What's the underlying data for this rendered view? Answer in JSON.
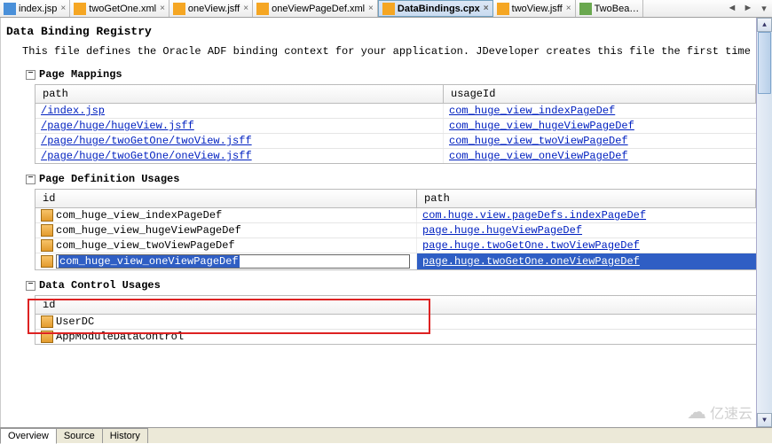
{
  "tabs": [
    {
      "label": "index.jsp",
      "icon": "jsp"
    },
    {
      "label": "twoGetOne.xml",
      "icon": "xml"
    },
    {
      "label": "oneView.jsff",
      "icon": "xml"
    },
    {
      "label": "oneViewPageDef.xml",
      "icon": "xml"
    },
    {
      "label": "DataBindings.cpx",
      "icon": "cpx",
      "active": true
    },
    {
      "label": "twoView.jsff",
      "icon": "xml"
    },
    {
      "label": "TwoBea…",
      "icon": "java"
    }
  ],
  "heading": "Data Binding Registry",
  "description": "This file defines the Oracle ADF binding context for your application. JDeveloper creates this file the first time you data bind a UI comp",
  "sections": {
    "pageMappings": {
      "title": "Page Mappings",
      "header": {
        "c1": "path",
        "c2": "usageId"
      },
      "rows": [
        {
          "path": "/index.jsp",
          "usage": "com_huge_view_indexPageDef"
        },
        {
          "path": "/page/huge/hugeView.jsff",
          "usage": "com_huge_view_hugeViewPageDef"
        },
        {
          "path": "/page/huge/twoGetOne/twoView.jsff",
          "usage": "com_huge_view_twoViewPageDef"
        },
        {
          "path": "/page/huge/twoGetOne/oneView.jsff",
          "usage": "com_huge_view_oneViewPageDef"
        }
      ]
    },
    "pageDefUsages": {
      "title": "Page Definition Usages",
      "header": {
        "c1": "id",
        "c2": "path"
      },
      "rows": [
        {
          "id": "com_huge_view_indexPageDef",
          "path": "com.huge.view.pageDefs.indexPageDef"
        },
        {
          "id": "com_huge_view_hugeViewPageDef",
          "path": "page.huge.hugeViewPageDef"
        },
        {
          "id": "com_huge_view_twoViewPageDef",
          "path": "page.huge.twoGetOne.twoViewPageDef"
        },
        {
          "id": "com_huge_view_oneViewPageDef",
          "path": "page.huge.twoGetOne.oneViewPageDef",
          "editing": true,
          "selected": true
        }
      ]
    },
    "dataControlUsages": {
      "title": "Data Control Usages",
      "header": {
        "c1": "id"
      },
      "rows": [
        {
          "id": "UserDC"
        },
        {
          "id": "AppModuleDataControl"
        }
      ]
    }
  },
  "bottomTabs": [
    "Overview",
    "Source",
    "History"
  ],
  "activeBottomTab": "Overview",
  "watermark": "亿速云",
  "collapseGlyph": "−"
}
